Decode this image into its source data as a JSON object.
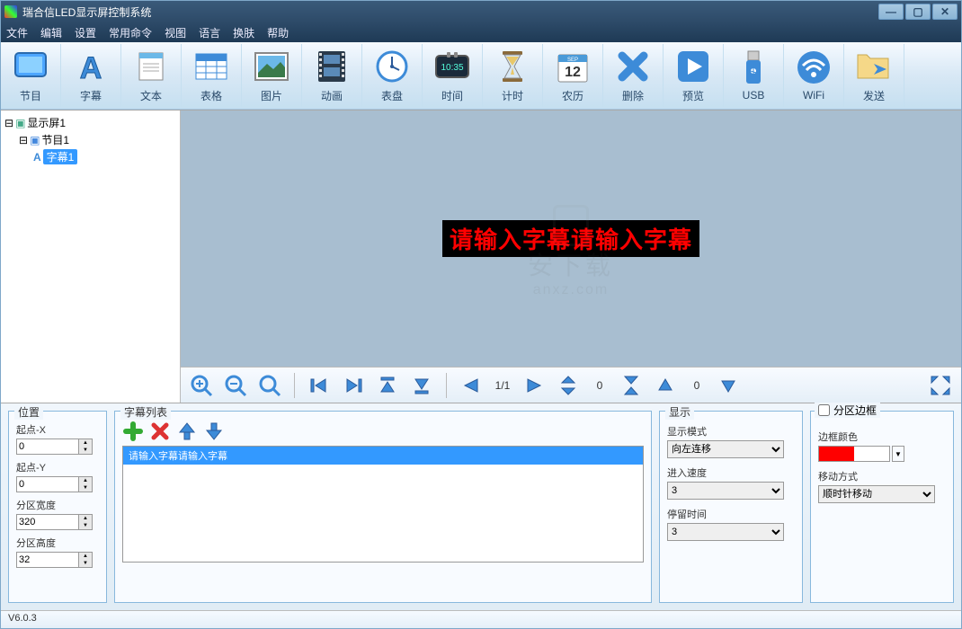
{
  "window": {
    "title": "瑞合信LED显示屏控制系统"
  },
  "menu": [
    "文件",
    "编辑",
    "设置",
    "常用命令",
    "视图",
    "语言",
    "换肤",
    "帮助"
  ],
  "toolbar": [
    {
      "k": "program",
      "label": "节目"
    },
    {
      "k": "subtitle",
      "label": "字幕"
    },
    {
      "k": "text",
      "label": "文本"
    },
    {
      "k": "table",
      "label": "表格"
    },
    {
      "k": "image",
      "label": "图片"
    },
    {
      "k": "animation",
      "label": "动画"
    },
    {
      "k": "dial",
      "label": "表盘"
    },
    {
      "k": "time",
      "label": "时间"
    },
    {
      "k": "timer",
      "label": "计时"
    },
    {
      "k": "calendar",
      "label": "农历"
    },
    {
      "k": "delete",
      "label": "删除"
    },
    {
      "k": "preview",
      "label": "预览"
    },
    {
      "k": "usb",
      "label": "USB"
    },
    {
      "k": "wifi",
      "label": "WiFi"
    },
    {
      "k": "send",
      "label": "发送"
    }
  ],
  "tree": {
    "root": "显示屏1",
    "program": "节目1",
    "subtitle": "字幕1"
  },
  "canvas": {
    "ledText": "请输入字幕请输入字幕",
    "page": "1/1",
    "vstep": "0",
    "hstep": "0"
  },
  "watermark": {
    "text": "安下载",
    "url": "anxz.com"
  },
  "pos": {
    "title": "位置",
    "startX": {
      "label": "起点-X",
      "value": "0"
    },
    "startY": {
      "label": "起点-Y",
      "value": "0"
    },
    "width": {
      "label": "分区宽度",
      "value": "320"
    },
    "height": {
      "label": "分区高度",
      "value": "32"
    }
  },
  "list": {
    "title": "字幕列表",
    "item": "请输入字幕请输入字幕"
  },
  "display": {
    "title": "显示",
    "mode": {
      "label": "显示模式",
      "value": "向左连移"
    },
    "speed": {
      "label": "进入速度",
      "value": "3"
    },
    "stay": {
      "label": "停留时间",
      "value": "3"
    }
  },
  "border": {
    "title": "分区边框",
    "colorLabel": "边框颜色",
    "moveLabel": "移动方式",
    "moveValue": "顺时针移动"
  },
  "status": "V6.0.3"
}
